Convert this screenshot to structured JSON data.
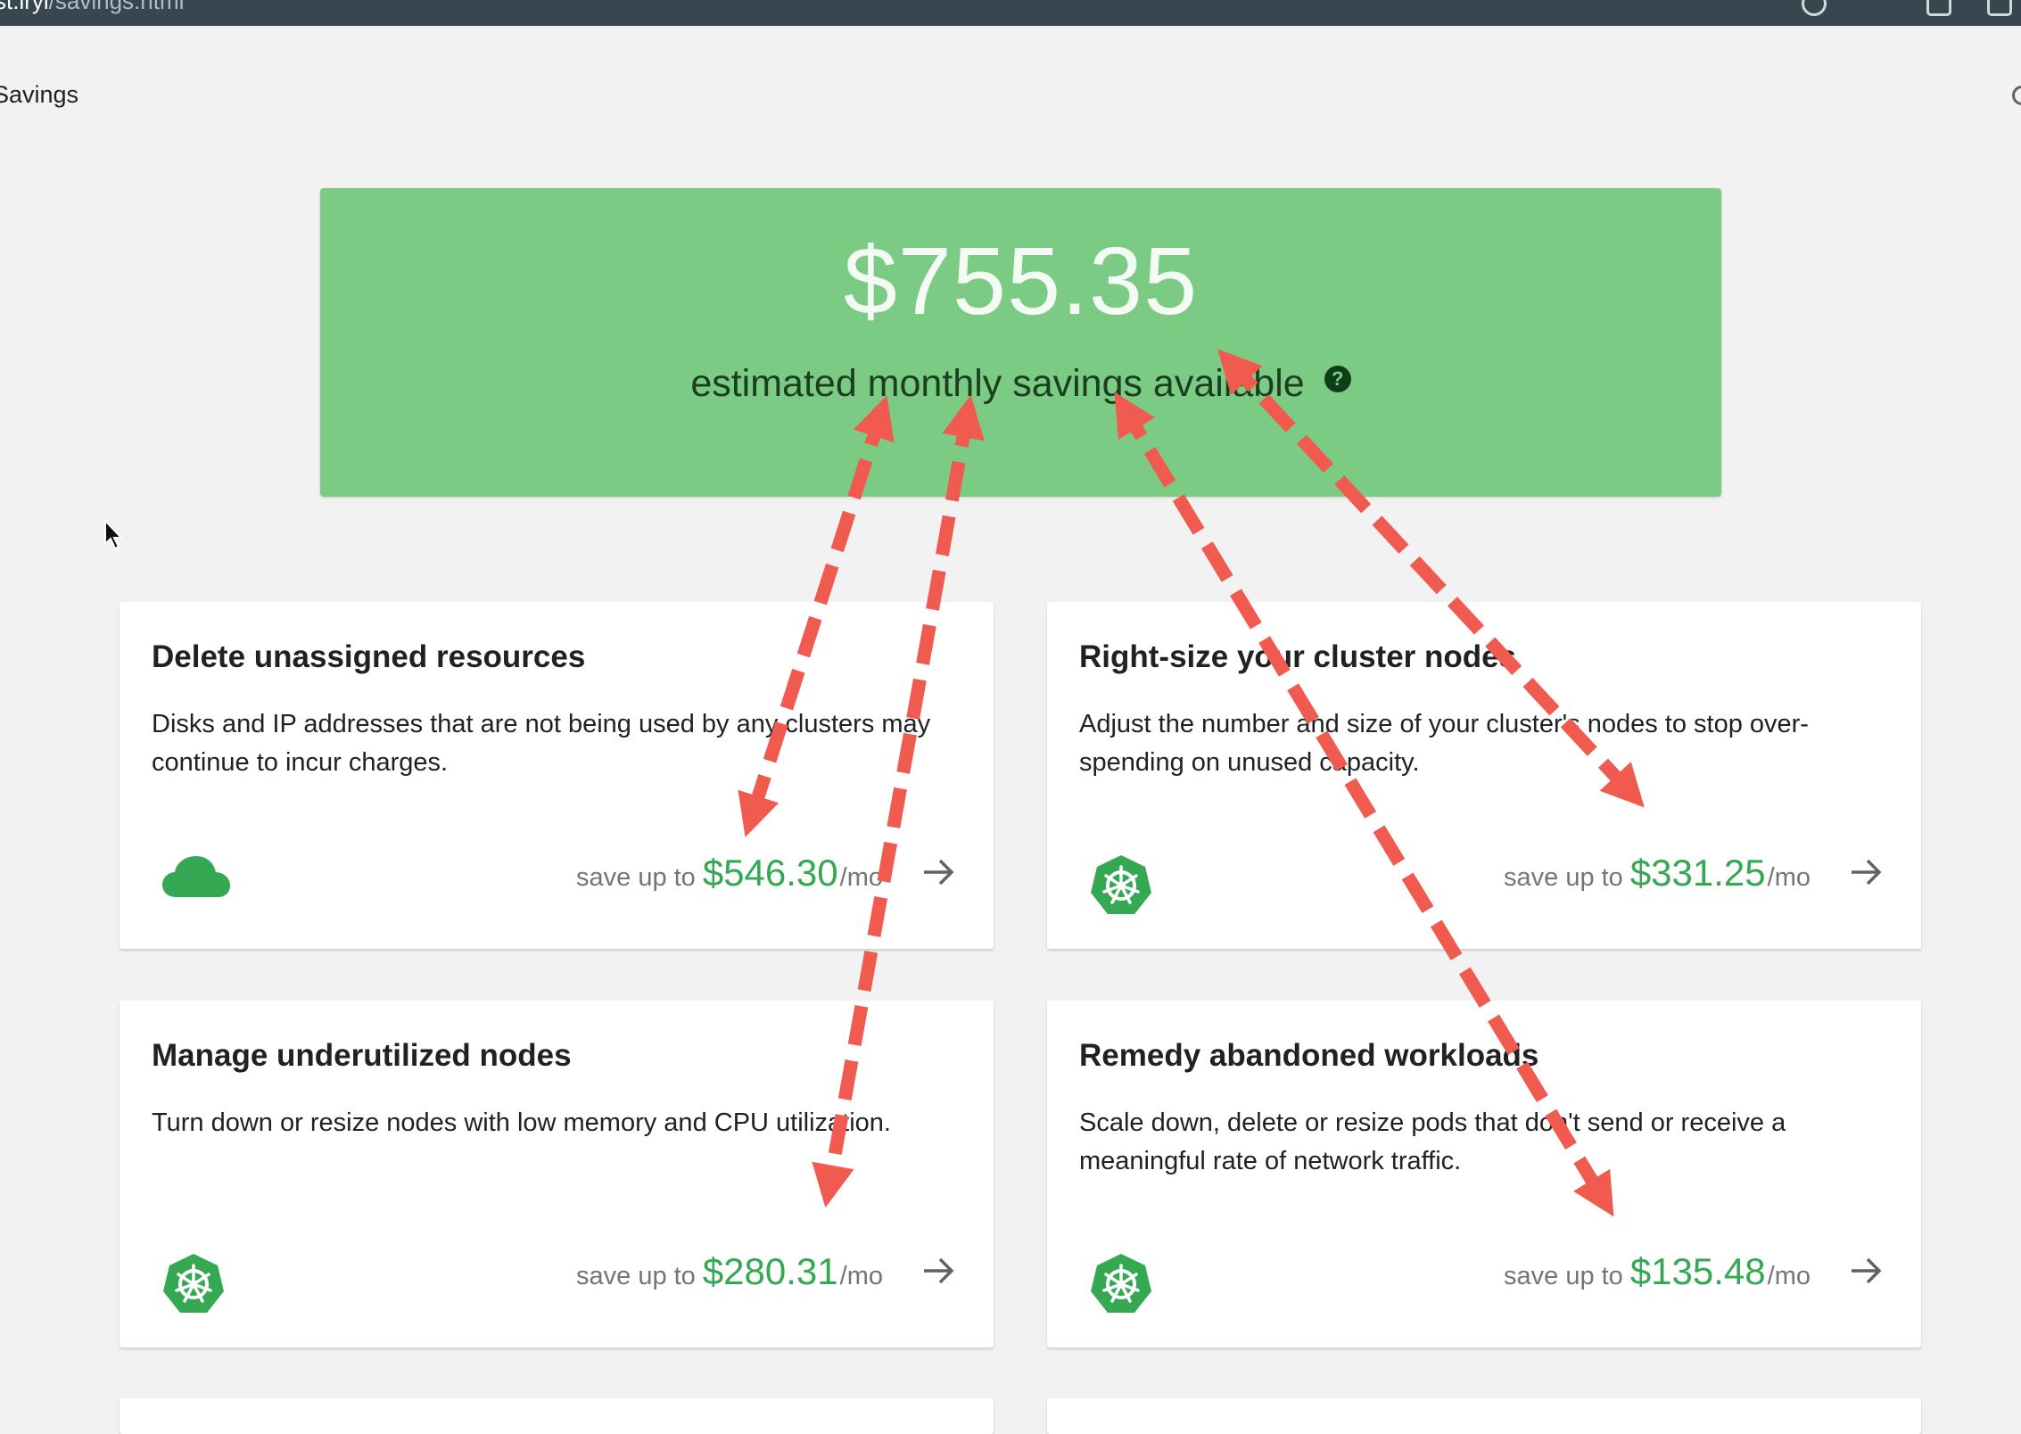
{
  "browser": {
    "url_host": "st.iryi",
    "url_path": "/savings.html"
  },
  "page": {
    "title": "Savings"
  },
  "hero": {
    "amount": "$755.35",
    "caption": "estimated monthly savings available",
    "help_icon": "?"
  },
  "cards": [
    {
      "title": "Delete unassigned resources",
      "description": "Disks and IP addresses that are not being used by any clusters may continue to incur charges.",
      "icon": "cloud-icon",
      "save_prefix": "save up to",
      "amount": "$546.30",
      "unit": "/mo"
    },
    {
      "title": "Right-size your cluster nodes",
      "description": "Adjust the number and size of your cluster's nodes to stop over-spending on unused capacity.",
      "icon": "kubernetes-icon",
      "save_prefix": "save up to",
      "amount": "$331.25",
      "unit": "/mo"
    },
    {
      "title": "Manage underutilized nodes",
      "description": "Turn down or resize nodes with low memory and CPU utilization.",
      "icon": "kubernetes-icon",
      "save_prefix": "save up to",
      "amount": "$280.31",
      "unit": "/mo"
    },
    {
      "title": "Remedy abandoned workloads",
      "description": "Scale down, delete or resize pods that don't send or receive a meaningful rate of network traffic.",
      "icon": "kubernetes-icon",
      "save_prefix": "save up to",
      "amount": "$135.48",
      "unit": "/mo"
    }
  ],
  "colors": {
    "hero_bg": "#7bcb85",
    "amount_green": "#34a853",
    "annotation_red": "#f05a4f"
  }
}
